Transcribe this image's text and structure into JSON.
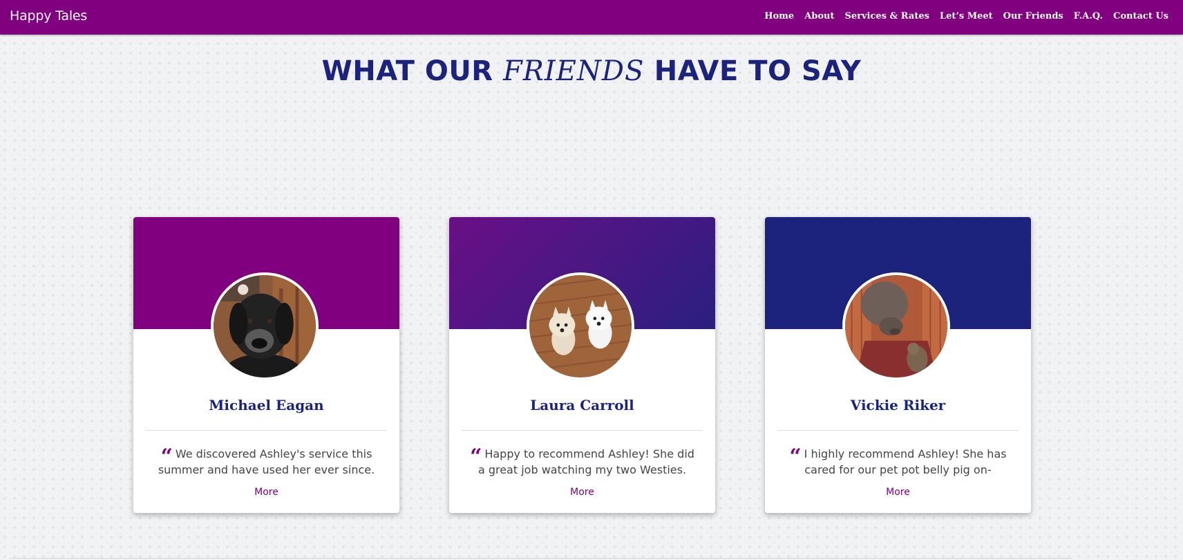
{
  "nav": {
    "brand": "Happy Tales",
    "links": [
      "Home",
      "About",
      "Services & Rates",
      "Let’s Meet",
      "Our Friends",
      "F.A.Q.",
      "Contact Us"
    ],
    "color": "#800080"
  },
  "heading": {
    "part1": "WHAT OUR ",
    "script": "FRIENDS",
    "part2": " HAVE TO SAY",
    "color": "#1b237d"
  },
  "testimonials": [
    {
      "name": "Michael Eagan",
      "quote": "We discovered Ashley's service this summer and have used her ever since.",
      "more": "More",
      "header_color": "#800080",
      "photo": "black-lab-dog-photo"
    },
    {
      "name": "Laura Carroll",
      "quote": "Happy to recommend Ashley! She did a great job watching my two Westies.",
      "more": "More",
      "header_color": "gradient #6a0f86 to #2a1f80",
      "photo": "two-westies-photo"
    },
    {
      "name": "Vickie Riker",
      "quote": "I highly recommend Ashley! She has cared for our pet pot belly pig on-",
      "more": "More",
      "header_color": "#1b237d",
      "photo": "pot-belly-pig-photo"
    }
  ],
  "icons": {
    "quote": "quote-left-icon"
  }
}
